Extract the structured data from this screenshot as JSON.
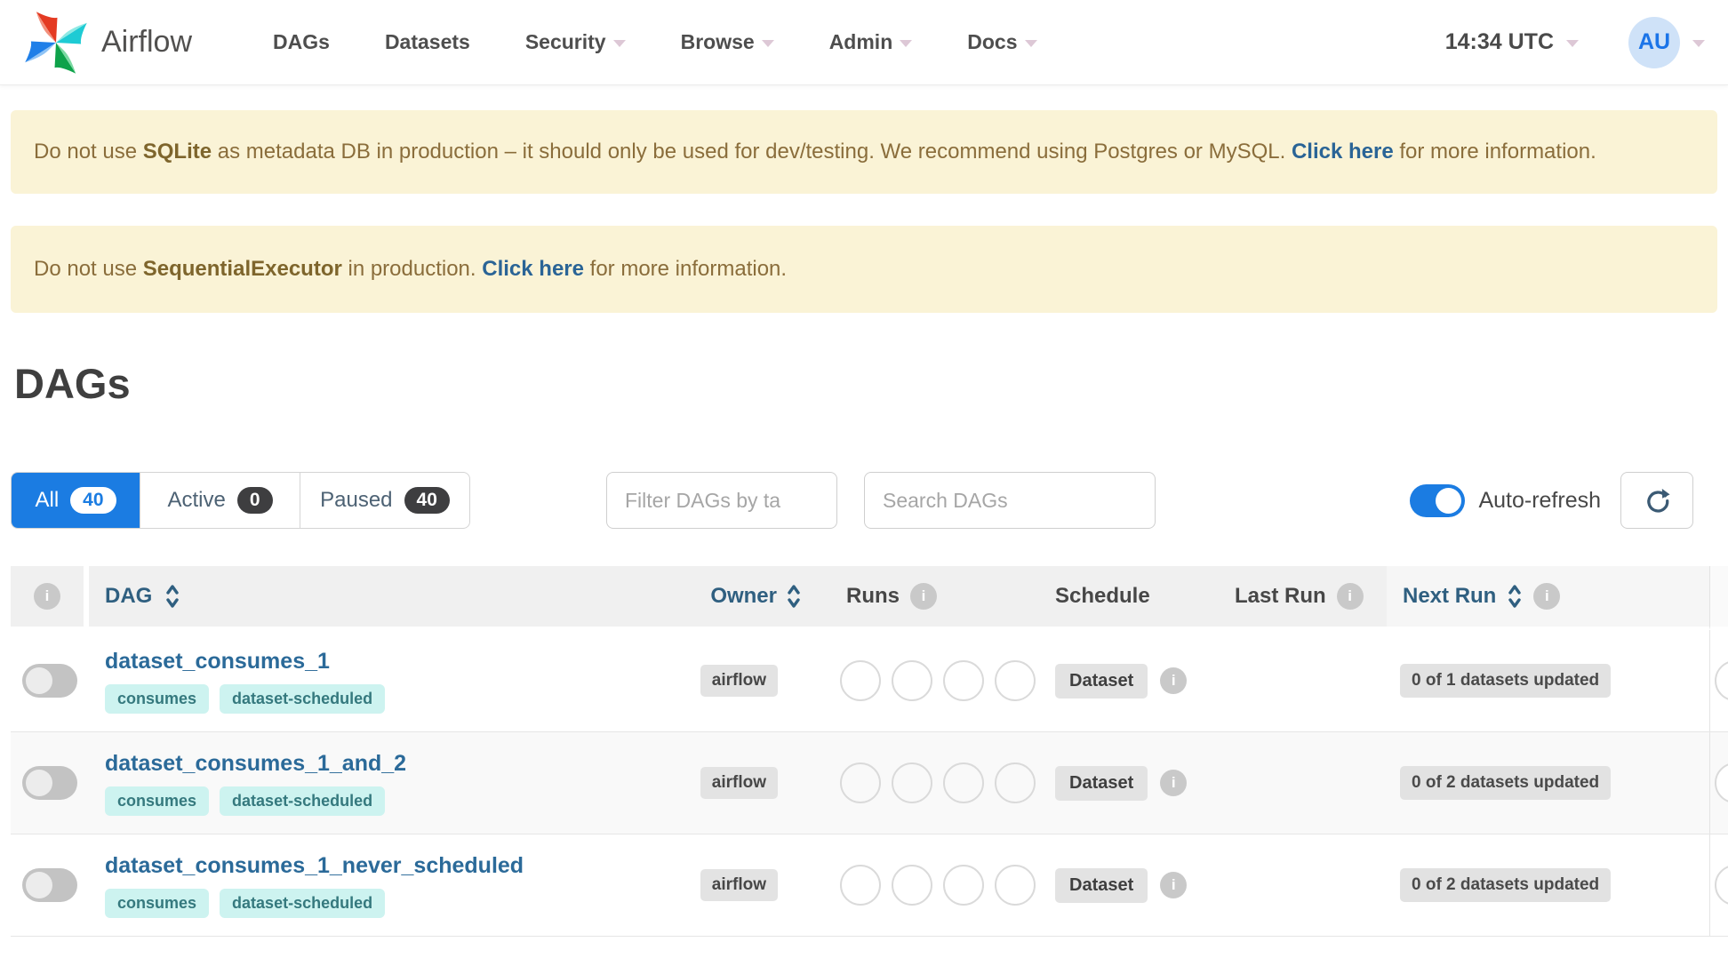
{
  "navbar": {
    "brand": "Airflow",
    "items": [
      {
        "label": "DAGs",
        "has_dropdown": false
      },
      {
        "label": "Datasets",
        "has_dropdown": false
      },
      {
        "label": "Security",
        "has_dropdown": true
      },
      {
        "label": "Browse",
        "has_dropdown": true
      },
      {
        "label": "Admin",
        "has_dropdown": true
      },
      {
        "label": "Docs",
        "has_dropdown": true
      }
    ],
    "clock": "14:34 UTC",
    "avatar_initials": "AU"
  },
  "alerts": [
    {
      "text_before": "Do not use ",
      "strong": "SQLite",
      "text_middle": " as metadata DB in production – it should only be used for dev/testing. We recommend using Postgres or MySQL. ",
      "link_label": "Click here",
      "text_after": " for more information."
    },
    {
      "text_before": "Do not use ",
      "strong": "SequentialExecutor",
      "text_middle": " in production. ",
      "link_label": "Click here",
      "text_after": " for more information."
    }
  ],
  "page_title": "DAGs",
  "filters": {
    "tabs": [
      {
        "label": "All",
        "count": "40",
        "active": true
      },
      {
        "label": "Active",
        "count": "0",
        "active": false
      },
      {
        "label": "Paused",
        "count": "40",
        "active": false
      }
    ],
    "tag_filter_placeholder": "Filter DAGs by ta",
    "search_placeholder": "Search DAGs",
    "auto_refresh_label": "Auto-refresh",
    "auto_refresh_on": true
  },
  "table": {
    "headers": {
      "dag": "DAG",
      "owner": "Owner",
      "runs": "Runs",
      "schedule": "Schedule",
      "last_run": "Last Run",
      "next_run": "Next Run"
    },
    "rows": [
      {
        "name": "dataset_consumes_1",
        "tags": [
          "consumes",
          "dataset-scheduled"
        ],
        "owner": "airflow",
        "schedule": "Dataset",
        "last_run": "",
        "next_run": "0 of 1 datasets updated",
        "paused": true
      },
      {
        "name": "dataset_consumes_1_and_2",
        "tags": [
          "consumes",
          "dataset-scheduled"
        ],
        "owner": "airflow",
        "schedule": "Dataset",
        "last_run": "",
        "next_run": "0 of 2 datasets updated",
        "paused": true
      },
      {
        "name": "dataset_consumes_1_never_scheduled",
        "tags": [
          "consumes",
          "dataset-scheduled"
        ],
        "owner": "airflow",
        "schedule": "Dataset",
        "last_run": "",
        "next_run": "0 of 2 datasets updated",
        "paused": true
      }
    ]
  },
  "colors": {
    "accent_blue": "#1b7ce2",
    "dag_link_blue": "#2b6a99",
    "sortable_header_blue": "#2f5f80",
    "banner_bg": "#faf3d6",
    "banner_text": "#8a6d3b",
    "banner_link": "#2a6496",
    "tag_bg": "#cdf3f0",
    "tag_text": "#35797e",
    "badge_bg": "#e3e3e3",
    "count_pill_dark": "#3e3e40",
    "avatar_bg": "#cfe2f8",
    "avatar_text": "#1b74e8"
  }
}
